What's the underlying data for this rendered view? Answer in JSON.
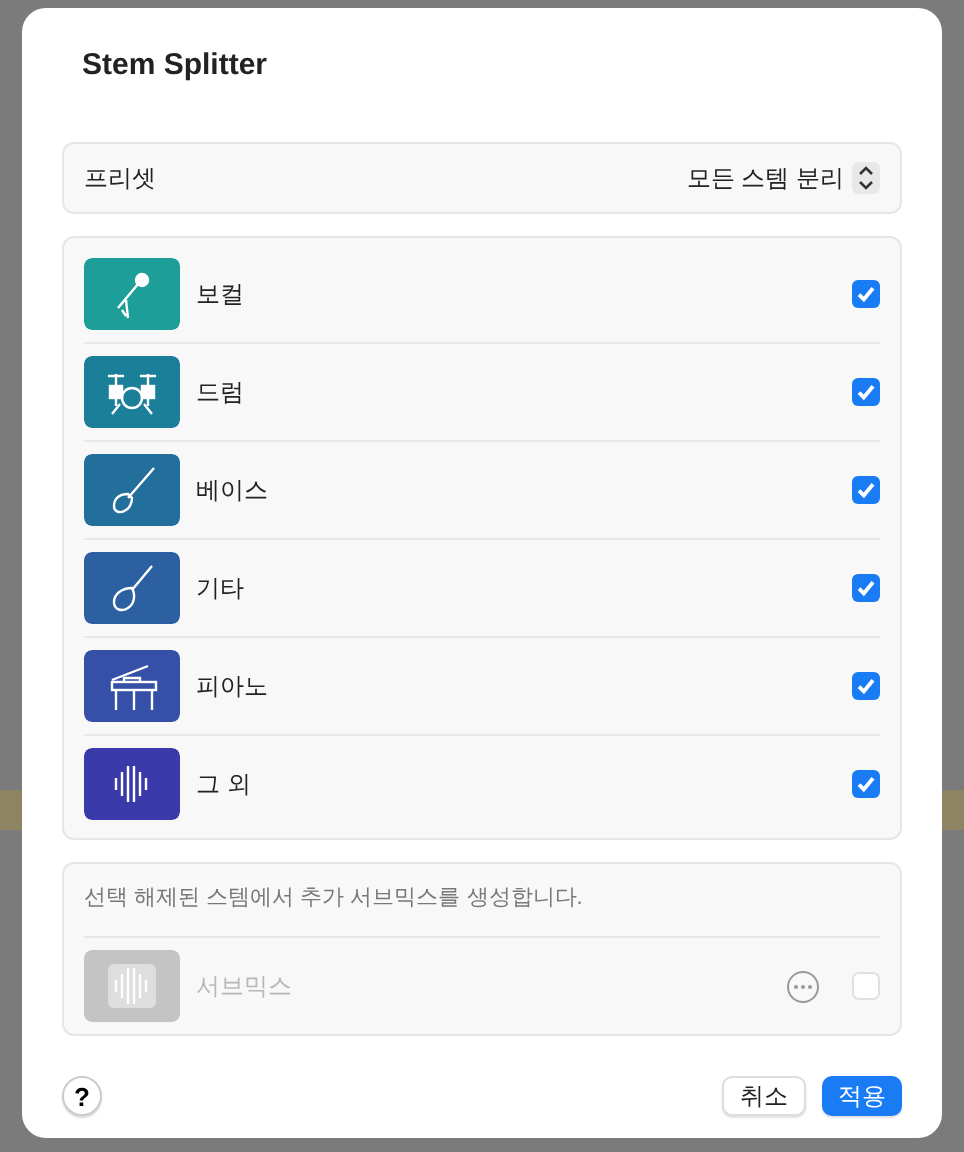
{
  "dialog": {
    "title": "Stem Splitter"
  },
  "preset": {
    "label": "프리셋",
    "value": "모든 스템 분리"
  },
  "stems": [
    {
      "kind": "vocals",
      "label": "보컬",
      "color": "#1e9e98",
      "checked": true
    },
    {
      "kind": "drums",
      "label": "드럼",
      "color": "#1b7f99",
      "checked": true
    },
    {
      "kind": "bass",
      "label": "베이스",
      "color": "#236f9b",
      "checked": true
    },
    {
      "kind": "guitar",
      "label": "기타",
      "color": "#2c60a0",
      "checked": true
    },
    {
      "kind": "piano",
      "label": "피아노",
      "color": "#3550a6",
      "checked": true
    },
    {
      "kind": "other",
      "label": "그 외",
      "color": "#3b3aaa",
      "checked": true
    }
  ],
  "submix": {
    "description": "선택 해제된 스템에서 추가 서브믹스를 생성합니다.",
    "label": "서브믹스",
    "disabled": true,
    "checked": false
  },
  "footer": {
    "help": "?",
    "buttons": [
      {
        "label": "취소",
        "kind": "secondary"
      },
      {
        "label": "적용",
        "kind": "primary"
      }
    ]
  }
}
